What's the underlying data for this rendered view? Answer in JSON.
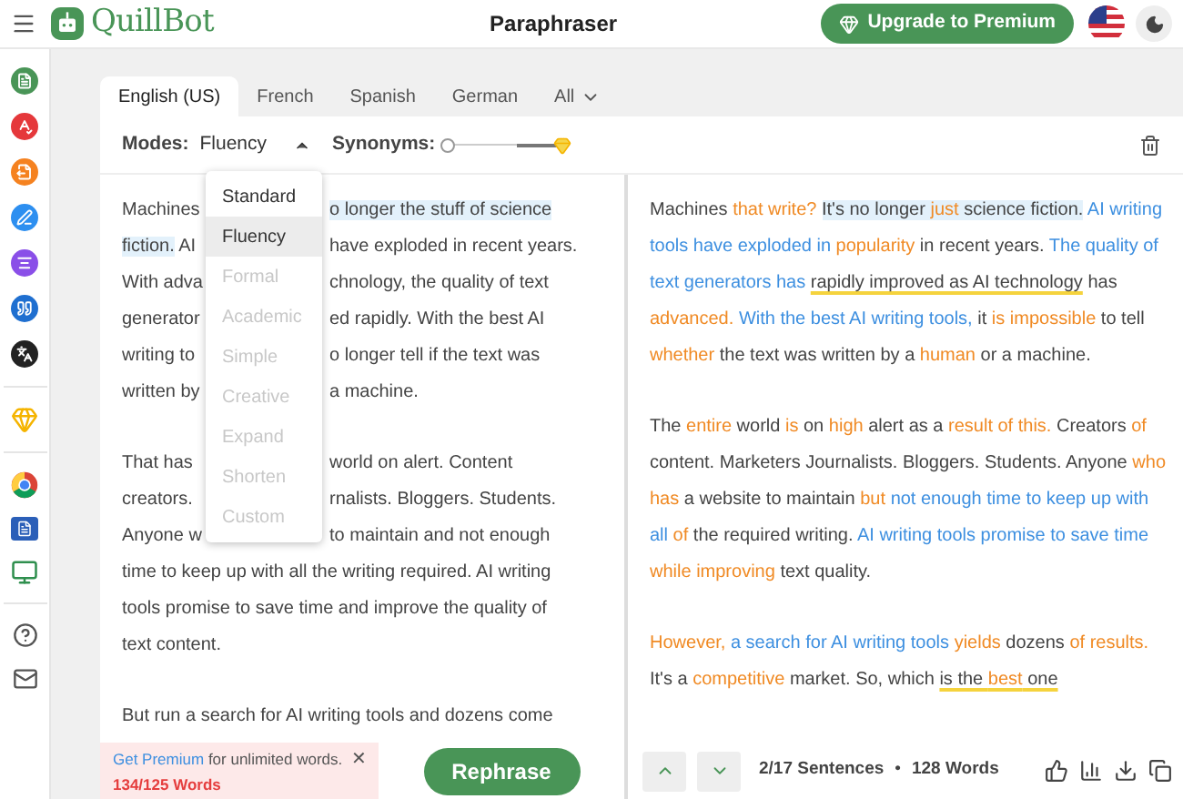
{
  "header": {
    "brand": "QuillBot",
    "title": "Paraphraser",
    "upgrade_button": "Upgrade to Premium"
  },
  "tabs": [
    {
      "label": "English (US)",
      "selected": true
    },
    {
      "label": "French",
      "selected": false
    },
    {
      "label": "Spanish",
      "selected": false
    },
    {
      "label": "German",
      "selected": false
    },
    {
      "label": "All",
      "selected": false
    }
  ],
  "toolbar": {
    "modes_label": "Modes:",
    "mode": "Fluency",
    "mode_expanded": true,
    "synonyms_label": "Synonyms:",
    "synonyms": {
      "level": 0
    }
  },
  "mode_options": [
    {
      "label": "Standard",
      "selected": false,
      "disabled": false
    },
    {
      "label": "Fluency",
      "selected": true,
      "disabled": false
    },
    {
      "label": "Formal",
      "selected": false,
      "disabled": true
    },
    {
      "label": "Academic",
      "selected": false,
      "disabled": true
    },
    {
      "label": "Simple",
      "selected": false,
      "disabled": true
    },
    {
      "label": "Creative",
      "selected": false,
      "disabled": true
    },
    {
      "label": "Expand",
      "selected": false,
      "disabled": true
    },
    {
      "label": "Shorten",
      "selected": false,
      "disabled": true
    },
    {
      "label": "Custom",
      "selected": false,
      "disabled": true
    }
  ],
  "input_paragraphs": [
    [
      {
        "left": [
          {
            "text": "Machines",
            "highlighted": false
          }
        ],
        "right": [
          {
            "text": "o longer the stuff of science",
            "highlighted": true
          }
        ]
      },
      {
        "left": [
          {
            "text": "fiction.",
            "highlighted": true
          },
          {
            "text": " AI",
            "highlighted": false
          }
        ],
        "right": [
          {
            "text": "have exploded in recent years.",
            "highlighted": false
          }
        ]
      },
      {
        "left": [
          {
            "text": "With adva",
            "highlighted": false
          }
        ],
        "right": [
          {
            "text": "chnology, the quality of text",
            "highlighted": false
          }
        ]
      },
      {
        "left": [
          {
            "text": "generator",
            "highlighted": false
          }
        ],
        "right": [
          {
            "text": "ed rapidly. With the best AI",
            "highlighted": false
          }
        ]
      },
      {
        "left": [
          {
            "text": "writing to",
            "highlighted": false
          }
        ],
        "right": [
          {
            "text": "o longer tell if the text was",
            "highlighted": false
          }
        ]
      },
      {
        "left": [
          {
            "text": "written by",
            "highlighted": false
          }
        ],
        "right": [
          {
            "text": "a machine.",
            "highlighted": false
          }
        ]
      }
    ],
    [
      {
        "left": [
          {
            "text": "That has",
            "highlighted": false
          }
        ],
        "right": [
          {
            "text": "world on alert. Content",
            "highlighted": false
          }
        ]
      },
      {
        "left": [
          {
            "text": "creators.",
            "highlighted": false
          }
        ],
        "right": [
          {
            "text": "rnalists. Bloggers. Students.",
            "highlighted": false
          }
        ]
      },
      {
        "left": [
          {
            "text": "Anyone w",
            "highlighted": false
          }
        ],
        "right": [
          {
            "text": "to maintain and not enough",
            "highlighted": false
          }
        ]
      },
      {
        "left": [
          {
            "text": "time to keep up with all the writing required. AI writing",
            "highlighted": false
          }
        ]
      },
      {
        "left": [
          {
            "text": "tools promise to save time and improve the quality of",
            "highlighted": false
          }
        ]
      },
      {
        "left": [
          {
            "text": "text content.",
            "highlighted": false
          }
        ]
      }
    ],
    [
      {
        "left": [
          {
            "text": "But run a search for AI writing tools and dozens come",
            "highlighted": false
          }
        ]
      }
    ]
  ],
  "output_paragraphs": [
    [
      {
        "text": "Machines ",
        "kind": "plain"
      },
      {
        "text": "that write? ",
        "kind": "changed"
      },
      {
        "text": "It's no longer ",
        "kind": "plain",
        "highlighted": true
      },
      {
        "text": "just",
        "kind": "changed",
        "highlighted": true
      },
      {
        "text": " science fiction.",
        "kind": "plain",
        "highlighted": true
      },
      {
        "text": " AI writing tools have exploded in ",
        "kind": "structure"
      },
      {
        "text": "popularity",
        "kind": "changed"
      },
      {
        "text": " in recent years. ",
        "kind": "plain"
      },
      {
        "text": "The quality of text generators has ",
        "kind": "structure"
      },
      {
        "text": "rapidly improved as AI technology",
        "kind": "plain",
        "underlined": true
      },
      {
        "text": " has ",
        "kind": "plain"
      },
      {
        "text": "advanced. ",
        "kind": "changed"
      },
      {
        "text": "With the best AI writing tools,",
        "kind": "structure"
      },
      {
        "text": " it ",
        "kind": "plain"
      },
      {
        "text": "is impossible",
        "kind": "changed"
      },
      {
        "text": " to tell ",
        "kind": "plain"
      },
      {
        "text": "whether",
        "kind": "changed"
      },
      {
        "text": " the text was written by a ",
        "kind": "plain"
      },
      {
        "text": "human",
        "kind": "changed"
      },
      {
        "text": " or a machine.",
        "kind": "plain"
      }
    ],
    [
      {
        "text": "The ",
        "kind": "plain"
      },
      {
        "text": "entire",
        "kind": "changed"
      },
      {
        "text": " world ",
        "kind": "plain"
      },
      {
        "text": "is",
        "kind": "changed"
      },
      {
        "text": " on ",
        "kind": "plain"
      },
      {
        "text": "high",
        "kind": "changed"
      },
      {
        "text": " alert as a ",
        "kind": "plain"
      },
      {
        "text": "result of this.",
        "kind": "changed"
      },
      {
        "text": " Creators ",
        "kind": "plain"
      },
      {
        "text": "of",
        "kind": "changed"
      },
      {
        "text": " content. Marketers Journalists. Bloggers. Students. Anyone ",
        "kind": "plain"
      },
      {
        "text": "who has",
        "kind": "changed"
      },
      {
        "text": " a website to maintain ",
        "kind": "plain"
      },
      {
        "text": "but ",
        "kind": "changed"
      },
      {
        "text": "not enough time to keep up with all ",
        "kind": "structure"
      },
      {
        "text": "of",
        "kind": "changed"
      },
      {
        "text": " the required writing. ",
        "kind": "plain"
      },
      {
        "text": "AI writing tools promise to save time ",
        "kind": "structure"
      },
      {
        "text": "while improving",
        "kind": "changed"
      },
      {
        "text": " text quality.",
        "kind": "plain"
      }
    ],
    [
      {
        "text": "However, ",
        "kind": "changed"
      },
      {
        "text": "a search for AI writing tools ",
        "kind": "structure"
      },
      {
        "text": "yields",
        "kind": "changed"
      },
      {
        "text": " dozens ",
        "kind": "plain"
      },
      {
        "text": "of results.",
        "kind": "changed"
      },
      {
        "text": " It's a ",
        "kind": "plain"
      },
      {
        "text": "competitive",
        "kind": "changed"
      },
      {
        "text": " market. So, which ",
        "kind": "plain"
      },
      {
        "text": "is the ",
        "kind": "plain",
        "underlined": true
      },
      {
        "text": "best",
        "kind": "changed",
        "underlined": true
      },
      {
        "text": " one",
        "kind": "plain",
        "underlined": true
      }
    ]
  ],
  "input_footer": {
    "link": "Get Premium",
    "message": " for unlimited words.",
    "close": "✕",
    "word_count": "134/125 Words",
    "button": "Rephrase"
  },
  "output_footer": {
    "sentences": "2/17 Sentences",
    "separator": "•",
    "words": "128 Words"
  }
}
